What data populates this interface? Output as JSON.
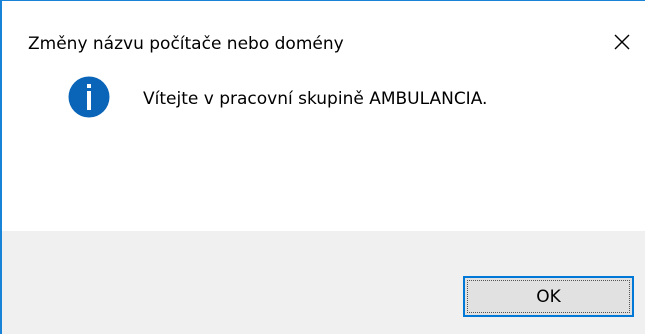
{
  "window": {
    "title": "Změny názvu počítače nebo domény",
    "accent_color": "#1883d7"
  },
  "title_bar": {
    "close_icon": "close-icon"
  },
  "message": {
    "icon": "info-icon",
    "icon_color": "#0a64b8",
    "text": "Vítejte v pracovní skupině AMBULANCIA."
  },
  "buttons": {
    "ok_label": "OK"
  }
}
